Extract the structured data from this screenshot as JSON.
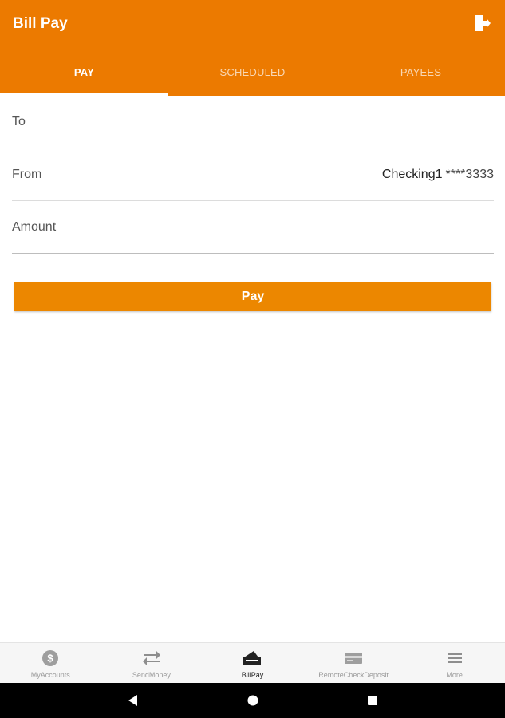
{
  "header": {
    "title": "Bill Pay",
    "logout_icon": "logout-icon",
    "color": "#ec7a00"
  },
  "tabs": [
    {
      "label": "PAY",
      "active": true
    },
    {
      "label": "SCHEDULED",
      "active": false
    },
    {
      "label": "PAYEES",
      "active": false
    }
  ],
  "form": {
    "to": {
      "label": "To",
      "value": ""
    },
    "from": {
      "label": "From",
      "account": "Checking1",
      "masked": "****3333"
    },
    "amount": {
      "label": "Amount",
      "value": ""
    }
  },
  "pay_button": {
    "label": "Pay",
    "color": "#ec8700"
  },
  "bottom_nav": [
    {
      "label": "MyAccounts",
      "icon": "dollar-circle-icon",
      "active": false
    },
    {
      "label": "SendMoney",
      "icon": "transfer-arrows-icon",
      "active": false
    },
    {
      "label": "BillPay",
      "icon": "bill-pay-icon",
      "active": true
    },
    {
      "label": "RemoteCheckDeposit",
      "icon": "card-icon",
      "active": false
    },
    {
      "label": "More",
      "icon": "menu-icon",
      "active": false
    }
  ],
  "system_nav": [
    "back-icon",
    "home-icon",
    "recents-icon"
  ]
}
